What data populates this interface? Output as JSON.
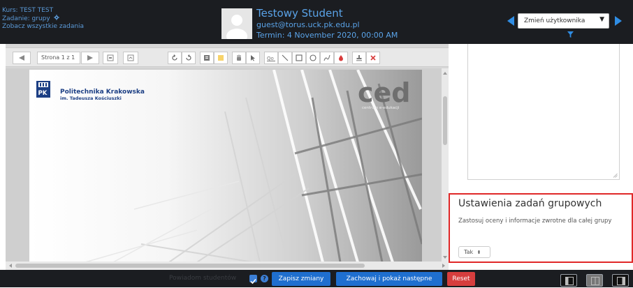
{
  "header": {
    "course_label": "Kurs: TEST TEST",
    "assignment_label": "Zadanie: grupy",
    "view_all_label": "Zobacz wszystkie zadania",
    "student_name": "Testowy Student",
    "student_email": "guest@torus.uck.pk.edu.pl",
    "due_date": "Termin: 4 November 2020, 00:00 AM",
    "change_user_label": "Zmień użytkownika"
  },
  "toolbar": {
    "page_selector": "Strona 1 z 1"
  },
  "document": {
    "university_name": "Politechnika Krakowska",
    "university_subtitle": "im. Tadeusza Kościuszki",
    "ced_text": "ced",
    "ced_subtitle": "centrum e-edukacji"
  },
  "group_settings": {
    "title": "Ustawienia zadań grupowych",
    "description": "Zastosuj oceny i informacje zwrotne dla całej grupy",
    "apply_value": "Tak"
  },
  "footer": {
    "notify_label": "Powiadom studentów",
    "save_label": "Zapisz zmiany",
    "save_next_label": "Zachowaj i pokaż następne",
    "reset_label": "Reset"
  },
  "colors": {
    "header_bg": "#1b1d21",
    "link_blue": "#5aa3e8",
    "primary_button": "#1f6fcf",
    "danger_button": "#d63e3e",
    "highlight_border": "#e02828"
  }
}
